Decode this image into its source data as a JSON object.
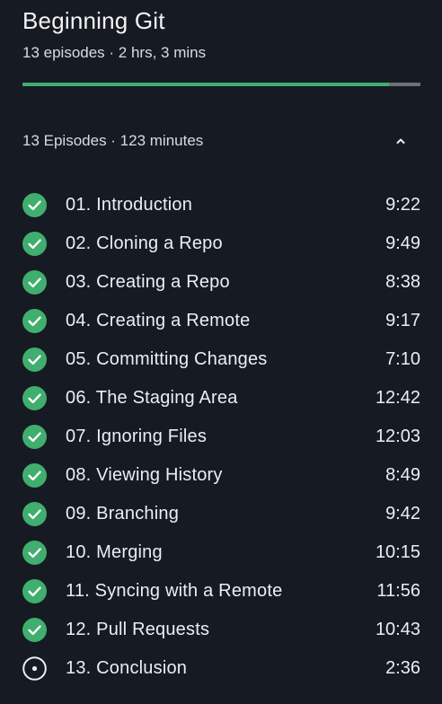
{
  "course": {
    "title": "Beginning Git",
    "meta": "13 episodes · 2 hrs, 3 mins",
    "progress_fraction": 0.922
  },
  "section": {
    "summary": "13 Episodes · 123 minutes",
    "toggle_icon": "chevron-up-icon",
    "expanded": true
  },
  "colors": {
    "background": "#161a22",
    "accent_green": "#3fae6e",
    "progress_track": "#6c7079",
    "text": "#eceef1"
  },
  "episodes": [
    {
      "title": "01. Introduction",
      "duration": "9:22",
      "status": "completed"
    },
    {
      "title": "02. Cloning a Repo",
      "duration": "9:49",
      "status": "completed"
    },
    {
      "title": "03. Creating a Repo",
      "duration": "8:38",
      "status": "completed"
    },
    {
      "title": "04. Creating a Remote",
      "duration": "9:17",
      "status": "completed"
    },
    {
      "title": "05. Committing Changes",
      "duration": "7:10",
      "status": "completed"
    },
    {
      "title": "06. The Staging Area",
      "duration": "12:42",
      "status": "completed"
    },
    {
      "title": "07. Ignoring Files",
      "duration": "12:03",
      "status": "completed"
    },
    {
      "title": "08. Viewing History",
      "duration": "8:49",
      "status": "completed"
    },
    {
      "title": "09. Branching",
      "duration": "9:42",
      "status": "completed"
    },
    {
      "title": "10. Merging",
      "duration": "10:15",
      "status": "completed"
    },
    {
      "title": "11. Syncing with a Remote",
      "duration": "11:56",
      "status": "completed"
    },
    {
      "title": "12. Pull Requests",
      "duration": "10:43",
      "status": "completed"
    },
    {
      "title": "13. Conclusion",
      "duration": "2:36",
      "status": "in-progress"
    }
  ]
}
